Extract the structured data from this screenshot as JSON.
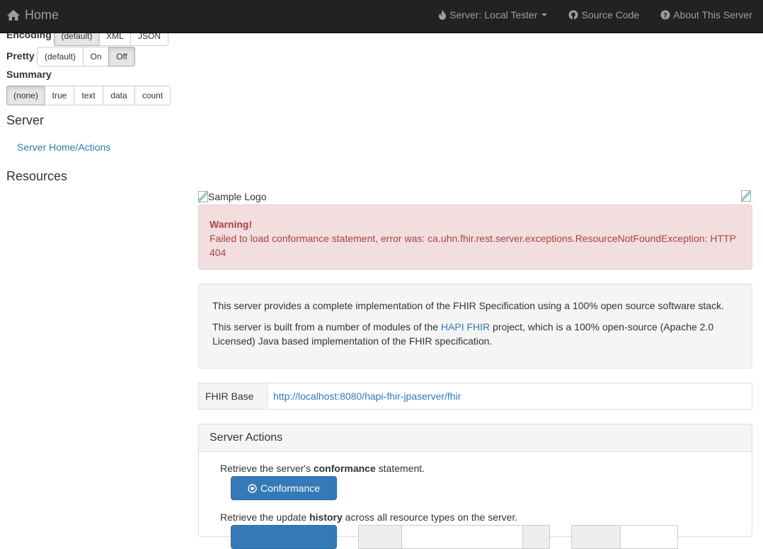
{
  "navbar": {
    "home_label": "Home",
    "server_label": "Server: Local Tester",
    "source_label": "Source Code",
    "about_label": "About This Server"
  },
  "sidebar": {
    "encoding": {
      "label": "Encoding",
      "options": [
        "(default)",
        "XML",
        "JSON"
      ],
      "selected": "(default)"
    },
    "pretty": {
      "label": "Pretty",
      "options": [
        "(default)",
        "On",
        "Off"
      ],
      "selected": "Off"
    },
    "summary": {
      "label": "Summary",
      "options": [
        "(none)",
        "true",
        "text",
        "data",
        "count"
      ],
      "selected": "(none)"
    },
    "server_heading": "Server",
    "server_link": "Server Home/Actions",
    "resources_heading": "Resources"
  },
  "main": {
    "logo_alt": "Sample Logo",
    "alert": {
      "title": "Warning!",
      "message": "Failed to load conformance statement, error was: ca.uhn.fhir.rest.server.exceptions.ResourceNotFoundException: HTTP 404"
    },
    "intro": {
      "p1": "This server provides a complete implementation of the FHIR Specification using a 100% open source software stack.",
      "p2_before": "This server is built from a number of modules of the ",
      "p2_link": "HAPI FHIR",
      "p2_after": " project, which is a 100% open-source (Apache 2.0 Licensed) Java based implementation of the FHIR specification."
    },
    "fhir_base": {
      "label": "FHIR Base",
      "value": "http://localhost:8080/hapi-fhir-jpaserver/fhir"
    },
    "server_actions": {
      "title": "Server Actions",
      "conformance_desc_before": "Retrieve the server's ",
      "conformance_desc_bold": "conformance",
      "conformance_desc_after": " statement.",
      "conformance_button": "Conformance",
      "history_desc_before": "Retrieve the update ",
      "history_desc_bold": "history",
      "history_desc_after": " across all resource types on the server."
    }
  },
  "colors": {
    "navbar_bg": "#222222",
    "link": "#337ab7",
    "primary": "#337ab7",
    "alert_bg": "#f2dede",
    "alert_text": "#a94442"
  }
}
